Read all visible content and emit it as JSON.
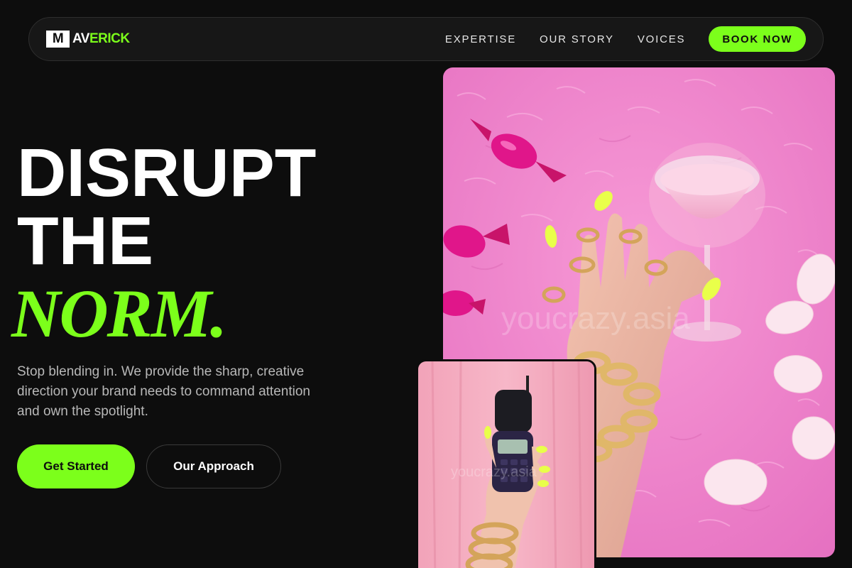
{
  "nav": {
    "logo_mark": "M",
    "logo_a": "AV",
    "logo_rest": "ERICK",
    "links": [
      "EXPERTISE",
      "OUR STORY",
      "VOICES"
    ],
    "cta": "BOOK NOW"
  },
  "hero": {
    "line1": "DISRUPT",
    "line2": "THE",
    "line3": "NORM.",
    "subtext": "Stop blending in. We provide the sharp, creative direction your brand needs to command attention and own the spotlight.",
    "primary_button": "Get Started",
    "secondary_button": "Our Approach"
  },
  "images": {
    "main_watermark": "youcrazy.asia",
    "small_watermark": "youcrazy.asia"
  },
  "colors": {
    "accent": "#7cff1b",
    "background": "#0d0d0d",
    "pink": "#f27fc4"
  }
}
